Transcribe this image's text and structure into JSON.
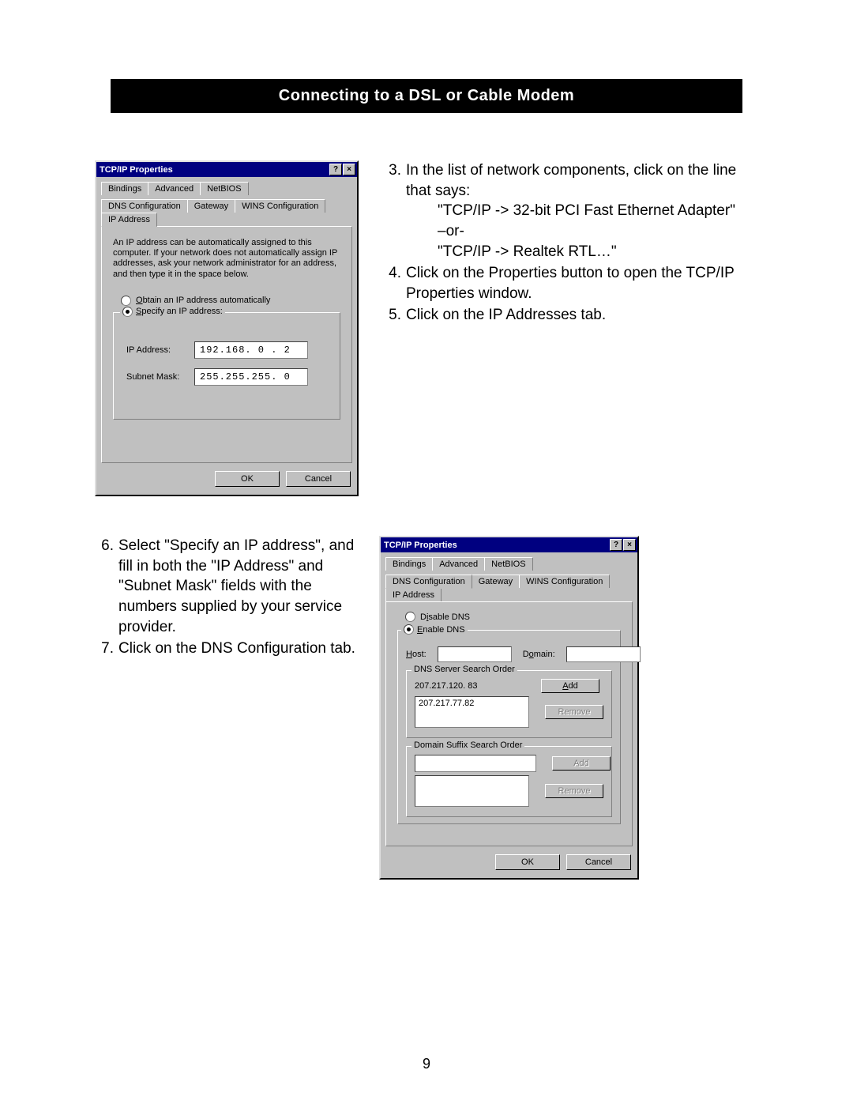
{
  "header": "Connecting to a DSL or Cable Modem",
  "page_number": "9",
  "dialog1": {
    "title": "TCP/IP Properties",
    "tabs_row1": [
      "Bindings",
      "Advanced",
      "NetBIOS"
    ],
    "tabs_row2": [
      "DNS Configuration",
      "Gateway",
      "WINS Configuration",
      "IP Address"
    ],
    "active_tab": "IP Address",
    "description": "An IP address can be automatically assigned to this computer. If your network does not automatically assign IP addresses, ask your network administrator for an address, and then type it in the space below.",
    "radio_auto": "Obtain an IP address automatically",
    "radio_specify": "Specify an IP address:",
    "ip_label": "IP Address:",
    "ip_value": "192.168. 0 . 2",
    "subnet_label": "Subnet Mask:",
    "subnet_value": "255.255.255. 0",
    "ok": "OK",
    "cancel": "Cancel"
  },
  "dialog2": {
    "title": "TCP/IP Properties",
    "tabs_row1": [
      "Bindings",
      "Advanced",
      "NetBIOS"
    ],
    "tabs_row2": [
      "DNS Configuration",
      "Gateway",
      "WINS Configuration",
      "IP Address"
    ],
    "active_tab": "DNS Configuration",
    "radio_disable": "Disable DNS",
    "radio_enable": "Enable DNS",
    "host_label": "Host:",
    "domain_label": "Domain:",
    "dns_order_label": "DNS Server Search Order",
    "dns_entry": "207.217.120. 83",
    "dns_list_item": "207.217.77.82",
    "add": "Add",
    "remove": "Remove",
    "suffix_label": "Domain Suffix Search Order",
    "ok": "OK",
    "cancel": "Cancel"
  },
  "instructions_a": {
    "s3_num": "3.",
    "s3": "In the list of network components, click on the line that says:",
    "s3a": "\"TCP/IP -> 32-bit PCI Fast Ethernet Adapter\"",
    "s3b": "–or-",
    "s3c": "\"TCP/IP -> Realtek RTL…\"",
    "s4_num": "4.",
    "s4": "Click on the Properties button to open the TCP/IP Properties window.",
    "s5_num": "5.",
    "s5": "Click on the IP Addresses tab."
  },
  "instructions_b": {
    "s6_num": "6.",
    "s6": "Select \"Specify an IP address\", and fill in both the \"IP Address\" and \"Subnet Mask\" fields with the numbers supplied by your service provider.",
    "s7_num": "7.",
    "s7": "Click on the DNS Configuration tab."
  }
}
